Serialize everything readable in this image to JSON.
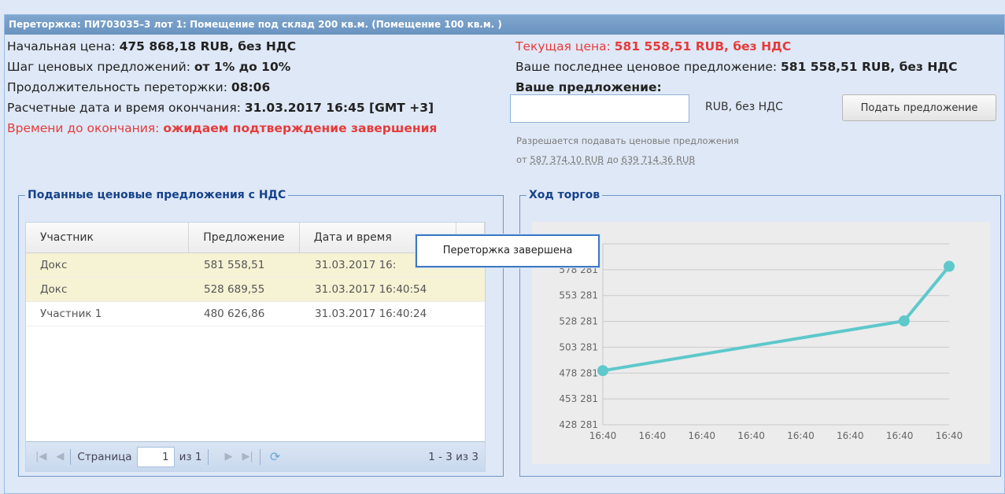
{
  "window": {
    "title": "Переторжка: ПИ703035–3 лот 1: Помещение под склад 200 кв.м. (Помещение 100 кв.м. )"
  },
  "info": {
    "start_price_label": "Начальная цена: ",
    "start_price_value": "475 868,18 RUB, без НДС",
    "step_label": "Шаг ценовых предложений: ",
    "step_value": "от 1% до 10%",
    "duration_label": "Продолжительность переторжки: ",
    "duration_value": "08:06",
    "end_label": "Расчетные дата и время окончания: ",
    "end_value": "31.03.2017 16:45 [GMT +3]",
    "remaining_label": "Времени до окончания: ",
    "remaining_value": "ожидаем подтверждение завершения"
  },
  "current": {
    "price_label": "Текущая цена: ",
    "price_value": "581 558,51 RUB, без НДС",
    "last_offer_label": "Ваше последнее ценовое предложение: ",
    "last_offer_value": "581 558,51 RUB, без НДС",
    "your_offer_label": "Ваше предложение:",
    "offer_input_value": "",
    "unit": "RUB, без НДС",
    "submit_label": "Подать предложение",
    "hint_line1": "Разрешается подавать ценовые предложения",
    "hint_from": "от ",
    "hint_min": "587 374,10 RUB",
    "hint_to": " до ",
    "hint_max": "639 714,36 RUB"
  },
  "offers_panel": {
    "legend": "Поданные ценовые предложения с НДС",
    "columns": [
      "Участник",
      "Предложение",
      "Дата и время",
      ""
    ],
    "rows": [
      {
        "participant": "Докс",
        "offer": "581 558,51",
        "datetime": "31.03.2017 16:",
        "highlighted": true
      },
      {
        "participant": "Докс",
        "offer": "528 689,55",
        "datetime": "31.03.2017 16:40:54",
        "highlighted": true
      },
      {
        "participant": "Участник 1",
        "offer": "480 626,86",
        "datetime": "31.03.2017 16:40:24",
        "highlighted": false
      }
    ],
    "pager": {
      "page_label": "Страница",
      "page_value": "1",
      "of_label": "из 1",
      "count": "1 - 3 из 3"
    }
  },
  "chart_panel": {
    "legend": "Ход торгов"
  },
  "tooltip": {
    "text": "Переторжка завершена"
  },
  "colors": {
    "titlebar": "#6f97c3",
    "accent_red": "#e53b3b",
    "line": "#5ec8cb",
    "highlight_row": "#f6f3d4"
  },
  "chart_data": {
    "type": "line",
    "y_ticks": [
      "428 281",
      "453 281",
      "478 281",
      "503 281",
      "528 281",
      "553 281",
      "578 281",
      "603 281"
    ],
    "y_tick_values": [
      428281,
      453281,
      478281,
      503281,
      528281,
      553281,
      578281,
      603281
    ],
    "x_ticks": [
      "16:40",
      "16:40",
      "16:40",
      "16:40",
      "16:40",
      "16:40",
      "16:40",
      "16:40"
    ],
    "ylim": [
      428281,
      603281
    ],
    "x": [
      0,
      0.87,
      1.0
    ],
    "values": [
      480626.86,
      528689.55,
      581558.51
    ],
    "grid": true
  }
}
